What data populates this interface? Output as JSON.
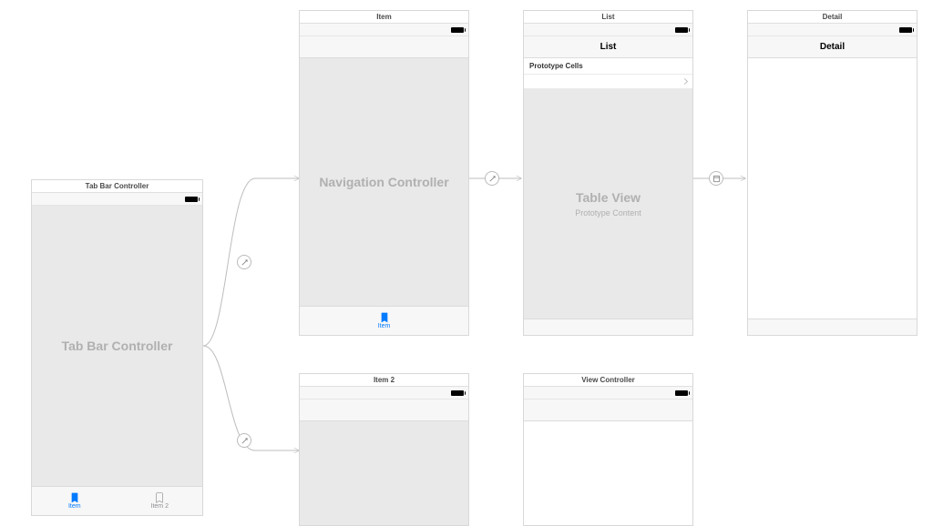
{
  "scenes": {
    "tabbar": {
      "title": "Tab Bar Controller",
      "body": "Tab Bar Controller",
      "tabs": [
        {
          "label": "Item",
          "active": true
        },
        {
          "label": "Item 2",
          "active": false
        }
      ]
    },
    "item": {
      "title": "Item",
      "body": "Navigation Controller",
      "tab_label": "Item"
    },
    "list": {
      "title": "List",
      "nav_title": "List",
      "prototype_header": "Prototype Cells",
      "body_title": "Table View",
      "body_subtitle": "Prototype Content"
    },
    "detail": {
      "title": "Detail",
      "nav_title": "Detail"
    },
    "item2": {
      "title": "Item 2"
    },
    "vc": {
      "title": "View Controller"
    }
  }
}
